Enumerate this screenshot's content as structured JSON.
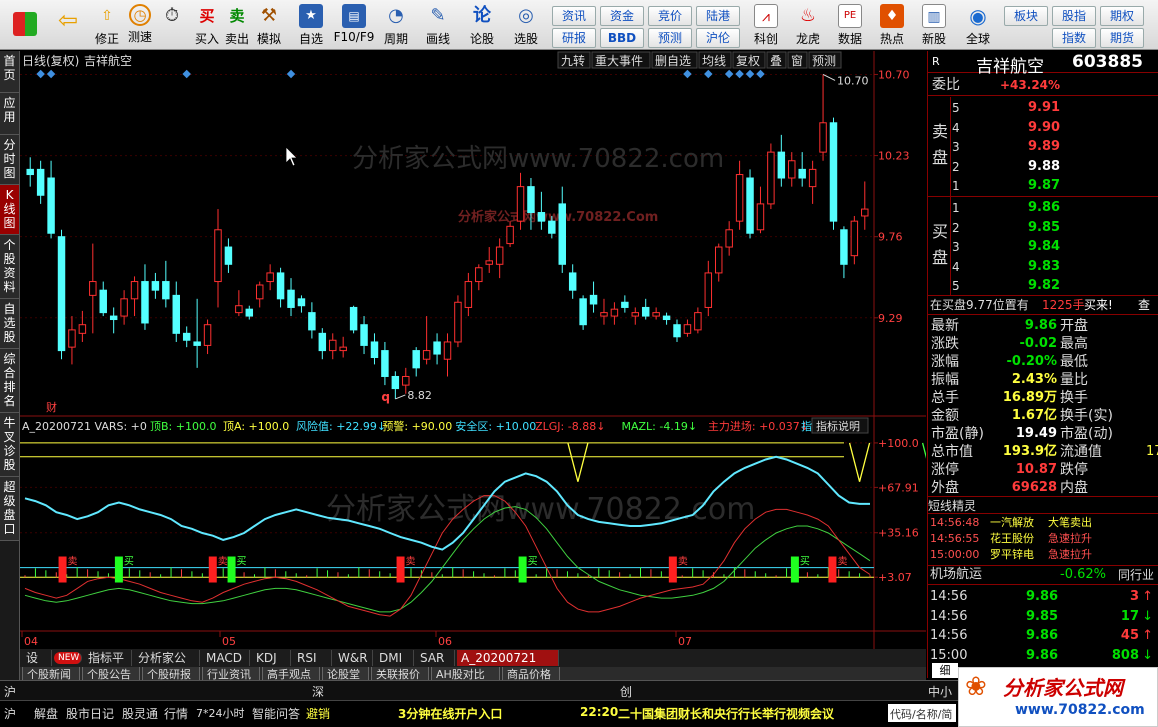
{
  "toolbar": {
    "buttons": [
      {
        "label": "",
        "icon": "grid-icon"
      },
      {
        "label": "",
        "icon": "back-arrow-icon"
      },
      {
        "label": "修正",
        "icon": "up-arrow-icon"
      },
      {
        "label": "测速",
        "icon": "clock-icon"
      },
      {
        "label": "买入",
        "icon": "buy-icon",
        "glyph": "买"
      },
      {
        "label": "卖出",
        "icon": "sell-icon",
        "glyph": "卖"
      },
      {
        "label": "模拟",
        "icon": "hammer-icon"
      },
      {
        "label": "自选",
        "icon": "star-icon"
      },
      {
        "label": "F10/F9",
        "icon": "f10-icon"
      },
      {
        "label": "周期",
        "icon": "period-icon"
      },
      {
        "label": "画线",
        "icon": "pencil-icon"
      },
      {
        "label": "论股",
        "icon": "discuss-icon",
        "glyph": "论"
      },
      {
        "label": "选股",
        "icon": "select-stock-icon"
      }
    ],
    "small_buttons": [
      "资讯",
      "资金",
      "竞价",
      "陆港",
      "研报",
      "BBD",
      "预测",
      "沪伦"
    ],
    "big_buttons": [
      {
        "label": "科创",
        "icon": "chart-icon"
      },
      {
        "label": "龙虎",
        "icon": "dragon-icon"
      },
      {
        "label": "数据",
        "icon": "data-icon"
      },
      {
        "label": "热点",
        "icon": "hot-icon"
      },
      {
        "label": "新股",
        "icon": "new-stock-icon"
      },
      {
        "label": "全球",
        "icon": "globe-icon"
      }
    ],
    "right_buttons": [
      "板块",
      "股指",
      "期权",
      "指数",
      "期货"
    ]
  },
  "sidebar": {
    "items": [
      {
        "label": "首页",
        "active": false
      },
      {
        "label": "应用",
        "active": false
      },
      {
        "label": "分时图",
        "active": false
      },
      {
        "label": "K线图",
        "active": true
      },
      {
        "label": "个股资料",
        "active": false
      },
      {
        "label": "自选股",
        "active": false
      },
      {
        "label": "综合排名",
        "active": false
      },
      {
        "label": "牛叉诊股",
        "active": false
      },
      {
        "label": "超级盘口",
        "active": false
      }
    ]
  },
  "chart_header": {
    "title": "日线(复权)",
    "stock": "吉祥航空",
    "tools": [
      "九转",
      "重大事件",
      "删自选",
      "均线",
      "复权",
      "叠",
      "窗",
      "预测"
    ]
  },
  "watermark": {
    "main": "分析家公式网www.70822.com",
    "small": "分析家公式网www.70822.Com"
  },
  "chart_data": [
    {
      "type": "candlestick",
      "title": "日线(复权)",
      "y_ticks": [
        "10.70",
        "10.23",
        "9.76",
        "9.29"
      ],
      "ylim": [
        8.75,
        10.72
      ],
      "high_label": "10.70",
      "low_label": "8.82",
      "fin_marker": "财",
      "q_marker": "q",
      "bull_color": "#ff3030",
      "bear_color": "#54ffff",
      "candles": [
        {
          "o": 10.15,
          "h": 10.22,
          "l": 10.05,
          "c": 10.12
        },
        {
          "o": 10.15,
          "h": 10.2,
          "l": 9.95,
          "c": 10.0
        },
        {
          "o": 10.1,
          "h": 10.2,
          "l": 9.75,
          "c": 9.78
        },
        {
          "o": 9.76,
          "h": 9.8,
          "l": 9.05,
          "c": 9.1
        },
        {
          "o": 9.12,
          "h": 9.3,
          "l": 9.02,
          "c": 9.22
        },
        {
          "o": 9.2,
          "h": 9.33,
          "l": 9.15,
          "c": 9.25
        },
        {
          "o": 9.42,
          "h": 9.72,
          "l": 9.2,
          "c": 9.5
        },
        {
          "o": 9.45,
          "h": 9.5,
          "l": 9.3,
          "c": 9.32
        },
        {
          "o": 9.3,
          "h": 9.35,
          "l": 9.2,
          "c": 9.28
        },
        {
          "o": 9.3,
          "h": 9.45,
          "l": 9.25,
          "c": 9.4
        },
        {
          "o": 9.4,
          "h": 9.53,
          "l": 9.3,
          "c": 9.5
        },
        {
          "o": 9.5,
          "h": 9.6,
          "l": 9.22,
          "c": 9.26
        },
        {
          "o": 9.5,
          "h": 9.55,
          "l": 9.4,
          "c": 9.45
        },
        {
          "o": 9.5,
          "h": 9.62,
          "l": 9.35,
          "c": 9.4
        },
        {
          "o": 9.42,
          "h": 9.5,
          "l": 9.15,
          "c": 9.2
        },
        {
          "o": 9.2,
          "h": 9.24,
          "l": 9.12,
          "c": 9.16
        },
        {
          "o": 9.15,
          "h": 9.4,
          "l": 9.0,
          "c": 9.13
        },
        {
          "o": 9.13,
          "h": 9.28,
          "l": 9.08,
          "c": 9.25
        },
        {
          "o": 9.5,
          "h": 9.92,
          "l": 9.35,
          "c": 9.8
        },
        {
          "o": 9.7,
          "h": 9.75,
          "l": 9.55,
          "c": 9.6
        },
        {
          "o": 9.32,
          "h": 9.45,
          "l": 9.3,
          "c": 9.36
        },
        {
          "o": 9.34,
          "h": 9.36,
          "l": 9.28,
          "c": 9.3
        },
        {
          "o": 9.4,
          "h": 9.5,
          "l": 9.35,
          "c": 9.48
        },
        {
          "o": 9.5,
          "h": 9.6,
          "l": 9.45,
          "c": 9.55
        },
        {
          "o": 9.55,
          "h": 9.58,
          "l": 9.35,
          "c": 9.4
        },
        {
          "o": 9.45,
          "h": 9.52,
          "l": 9.3,
          "c": 9.35
        },
        {
          "o": 9.4,
          "h": 9.42,
          "l": 9.32,
          "c": 9.36
        },
        {
          "o": 9.32,
          "h": 9.38,
          "l": 9.17,
          "c": 9.22
        },
        {
          "o": 9.2,
          "h": 9.23,
          "l": 9.05,
          "c": 9.1
        },
        {
          "o": 9.1,
          "h": 9.2,
          "l": 9.05,
          "c": 9.16
        },
        {
          "o": 9.1,
          "h": 9.18,
          "l": 9.06,
          "c": 9.12
        },
        {
          "o": 9.35,
          "h": 9.36,
          "l": 9.2,
          "c": 9.22
        },
        {
          "o": 9.25,
          "h": 9.3,
          "l": 9.08,
          "c": 9.13
        },
        {
          "o": 9.15,
          "h": 9.2,
          "l": 9.02,
          "c": 9.06
        },
        {
          "o": 9.1,
          "h": 9.15,
          "l": 8.9,
          "c": 8.95
        },
        {
          "o": 8.95,
          "h": 8.98,
          "l": 8.82,
          "c": 8.88
        },
        {
          "o": 8.9,
          "h": 9.0,
          "l": 8.85,
          "c": 8.95
        },
        {
          "o": 9.1,
          "h": 9.12,
          "l": 8.95,
          "c": 9.0
        },
        {
          "o": 9.05,
          "h": 9.3,
          "l": 9.02,
          "c": 9.1
        },
        {
          "o": 9.15,
          "h": 9.2,
          "l": 9.02,
          "c": 9.08
        },
        {
          "o": 9.05,
          "h": 9.2,
          "l": 8.95,
          "c": 9.15
        },
        {
          "o": 9.15,
          "h": 9.42,
          "l": 9.12,
          "c": 9.38
        },
        {
          "o": 9.35,
          "h": 9.55,
          "l": 9.3,
          "c": 9.5
        },
        {
          "o": 9.5,
          "h": 9.6,
          "l": 9.45,
          "c": 9.58
        },
        {
          "o": 9.6,
          "h": 9.7,
          "l": 9.55,
          "c": 9.62
        },
        {
          "o": 9.6,
          "h": 9.75,
          "l": 9.52,
          "c": 9.7
        },
        {
          "o": 9.72,
          "h": 9.85,
          "l": 9.7,
          "c": 9.82
        },
        {
          "o": 9.85,
          "h": 10.13,
          "l": 9.8,
          "c": 10.05
        },
        {
          "o": 10.05,
          "h": 10.1,
          "l": 9.8,
          "c": 9.9
        },
        {
          "o": 9.9,
          "h": 10.02,
          "l": 9.8,
          "c": 9.85
        },
        {
          "o": 9.85,
          "h": 9.88,
          "l": 9.75,
          "c": 9.78
        },
        {
          "o": 9.95,
          "h": 10.05,
          "l": 9.55,
          "c": 9.6
        },
        {
          "o": 9.55,
          "h": 9.6,
          "l": 9.4,
          "c": 9.45
        },
        {
          "o": 9.4,
          "h": 9.42,
          "l": 9.22,
          "c": 9.25
        },
        {
          "o": 9.42,
          "h": 9.5,
          "l": 9.32,
          "c": 9.37
        },
        {
          "o": 9.3,
          "h": 9.4,
          "l": 9.25,
          "c": 9.32
        },
        {
          "o": 9.3,
          "h": 9.38,
          "l": 9.25,
          "c": 9.34
        },
        {
          "o": 9.38,
          "h": 9.42,
          "l": 9.32,
          "c": 9.35
        },
        {
          "o": 9.3,
          "h": 9.35,
          "l": 9.25,
          "c": 9.32
        },
        {
          "o": 9.35,
          "h": 9.4,
          "l": 9.28,
          "c": 9.3
        },
        {
          "o": 9.3,
          "h": 9.35,
          "l": 9.28,
          "c": 9.32
        },
        {
          "o": 9.3,
          "h": 9.32,
          "l": 9.25,
          "c": 9.28
        },
        {
          "o": 9.25,
          "h": 9.28,
          "l": 9.15,
          "c": 9.18
        },
        {
          "o": 9.2,
          "h": 9.28,
          "l": 9.18,
          "c": 9.25
        },
        {
          "o": 9.22,
          "h": 9.35,
          "l": 9.2,
          "c": 9.32
        },
        {
          "o": 9.35,
          "h": 9.62,
          "l": 9.3,
          "c": 9.55
        },
        {
          "o": 9.55,
          "h": 9.72,
          "l": 9.5,
          "c": 9.7
        },
        {
          "o": 9.7,
          "h": 9.85,
          "l": 9.65,
          "c": 9.8
        },
        {
          "o": 9.85,
          "h": 10.2,
          "l": 9.8,
          "c": 10.12
        },
        {
          "o": 10.1,
          "h": 10.15,
          "l": 9.75,
          "c": 9.78
        },
        {
          "o": 9.8,
          "h": 10.05,
          "l": 9.78,
          "c": 9.95
        },
        {
          "o": 9.95,
          "h": 10.3,
          "l": 9.92,
          "c": 10.25
        },
        {
          "o": 10.25,
          "h": 10.35,
          "l": 10.05,
          "c": 10.1
        },
        {
          "o": 10.1,
          "h": 10.25,
          "l": 10.05,
          "c": 10.2
        },
        {
          "o": 10.15,
          "h": 10.25,
          "l": 10.05,
          "c": 10.1
        },
        {
          "o": 10.05,
          "h": 10.2,
          "l": 9.95,
          "c": 10.15
        },
        {
          "o": 10.25,
          "h": 10.7,
          "l": 10.2,
          "c": 10.42
        },
        {
          "o": 10.42,
          "h": 10.45,
          "l": 9.8,
          "c": 9.85
        },
        {
          "o": 9.8,
          "h": 9.82,
          "l": 9.52,
          "c": 9.6
        },
        {
          "o": 9.65,
          "h": 9.88,
          "l": 9.6,
          "c": 9.85
        },
        {
          "o": 9.88,
          "h": 10.08,
          "l": 9.8,
          "c": 9.92
        }
      ],
      "top_markers": [
        1,
        2,
        15,
        25,
        63,
        65,
        67,
        68,
        69,
        70
      ]
    },
    {
      "type": "line",
      "title": "A_20200721 VARS: +0",
      "legend": [
        {
          "text": "顶B: +100.0",
          "color": "#40ff40"
        },
        {
          "text": "顶A: +100.0",
          "color": "#ffff40"
        },
        {
          "text": "风险值: +22.99↓",
          "color": "#40e0ff"
        },
        {
          "text": "预警: +90.00",
          "color": "#ffff40"
        },
        {
          "text": "安全区: +10.00",
          "color": "#40e0ff"
        },
        {
          "text": "ZLGJ: -8.88↓",
          "color": "#ff3b3b"
        },
        {
          "text": "MAZL: -4.19↓",
          "color": "#40ff40"
        },
        {
          "text": "主力进场: +0.037↓",
          "color": "#ff3b3b"
        },
        {
          "text": "指标:",
          "color": "#40e0ff"
        }
      ],
      "explain_label": "指标说明",
      "y_ticks": [
        "+100.0",
        "+67.91",
        "+35.16",
        "+3.07"
      ],
      "ylim": [
        -30,
        105
      ],
      "risk_line": [
        60,
        58,
        55,
        50,
        48,
        45,
        47,
        50,
        55,
        57,
        55,
        52,
        50,
        48,
        45,
        40,
        38,
        35,
        33,
        30,
        32,
        35,
        40,
        45,
        48,
        50,
        52,
        50,
        48,
        46,
        45,
        44,
        42,
        40,
        38,
        35,
        32,
        30,
        28,
        25,
        23,
        28,
        35,
        45,
        55,
        65,
        72,
        75,
        78,
        76,
        72,
        65,
        55,
        48,
        45,
        43,
        42,
        41,
        40,
        40,
        41,
        42,
        44,
        46,
        48,
        55,
        65,
        72,
        78,
        82,
        85,
        88,
        90,
        88,
        85,
        82,
        78,
        70,
        62,
        57,
        56,
        56
      ],
      "red_line": [
        -5,
        -8,
        -10,
        -12,
        -10,
        -5,
        0,
        2,
        3,
        2,
        0,
        -2,
        -5,
        -8,
        -10,
        -12,
        -14,
        -15,
        -12,
        -8,
        -5,
        -2,
        0,
        2,
        3,
        2,
        0,
        -3,
        -6,
        -10,
        -14,
        -18,
        -20,
        -22,
        -24,
        -25,
        -20,
        -10,
        5,
        20,
        35,
        45,
        52,
        58,
        62,
        62,
        58,
        50,
        40,
        25,
        10,
        -5,
        -15,
        -20,
        -22,
        -22,
        -20,
        -18,
        -15,
        -12,
        -10,
        -8,
        -6,
        -5,
        -4,
        -2,
        5,
        15,
        28,
        38,
        45,
        50,
        52,
        52,
        50,
        48,
        45,
        40,
        30,
        20,
        10,
        5
      ],
      "green_line": [
        -10,
        -12,
        -14,
        -15,
        -14,
        -12,
        -10,
        -8,
        -6,
        -5,
        -6,
        -8,
        -10,
        -12,
        -14,
        -15,
        -16,
        -16,
        -15,
        -14,
        -12,
        -10,
        -8,
        -6,
        -5,
        -5,
        -6,
        -8,
        -10,
        -12,
        -14,
        -16,
        -18,
        -20,
        -22,
        -22,
        -20,
        -15,
        -8,
        0,
        10,
        20,
        30,
        38,
        45,
        50,
        53,
        54,
        52,
        46,
        38,
        28,
        18,
        10,
        5,
        0,
        -3,
        -6,
        -8,
        -10,
        -11,
        -12,
        -12,
        -11,
        -10,
        -8,
        -5,
        0,
        8,
        16,
        24,
        30,
        35,
        38,
        40,
        40,
        38,
        35,
        30,
        25,
        20,
        15
      ],
      "safe_level": 10,
      "alert_level": 90,
      "top_level": 100,
      "buy_markers": [
        [
          4,
          "卖"
        ],
        [
          20,
          "卖"
        ],
        [
          40,
          "卖"
        ],
        [
          69,
          "卖"
        ],
        [
          86,
          "卖"
        ]
      ],
      "sell_markers": [
        [
          10,
          "买"
        ],
        [
          22,
          "买"
        ],
        [
          53,
          "买"
        ],
        [
          82,
          "买"
        ]
      ],
      "v_markers": [
        53,
        80,
        87
      ]
    }
  ],
  "x_axis_labels": [
    "04",
    "05",
    "06",
    "07"
  ],
  "cursor": {
    "shown": true
  },
  "bottom_tabs": [
    "设置",
    "NEW",
    "指标平台",
    "分析家公式网",
    "MACD",
    "KDJ",
    "RSI",
    "W&R",
    "DMI",
    "SAR",
    "A_20200721"
  ],
  "info_tabs": [
    "个股新闻",
    "个股公告",
    "个股研报",
    "行业资讯",
    "高手观点",
    "论股堂",
    "关联报价",
    "AH股对比",
    "商品价格"
  ],
  "quote": {
    "r_flag": "R",
    "name": "吉祥航空",
    "code": "603885",
    "webi_label": "委比",
    "webi": "+43.24%",
    "sell_label": [
      "卖",
      "盘"
    ],
    "buy_label": [
      "买",
      "盘"
    ],
    "asks": [
      {
        "lv": "5",
        "p": "9.91"
      },
      {
        "lv": "4",
        "p": "9.90"
      },
      {
        "lv": "3",
        "p": "9.89"
      },
      {
        "lv": "2",
        "p": "9.88"
      },
      {
        "lv": "1",
        "p": "9.87"
      }
    ],
    "bids": [
      {
        "lv": "1",
        "p": "9.86"
      },
      {
        "lv": "2",
        "p": "9.85"
      },
      {
        "lv": "3",
        "p": "9.84"
      },
      {
        "lv": "4",
        "p": "9.83"
      },
      {
        "lv": "5",
        "p": "9.82"
      }
    ],
    "buy_position_text": "在买盘9.77位置有",
    "buy_position_vol": "1225手",
    "buy_button": "买来!",
    "check_button": "查",
    "stats": [
      {
        "l": "最新",
        "v": "9.86",
        "c": "grn",
        "l2": "开盘",
        "v2": ""
      },
      {
        "l": "涨跌",
        "v": "-0.02",
        "c": "grn",
        "l2": "最高",
        "v2": ""
      },
      {
        "l": "涨幅",
        "v": "-0.20%",
        "c": "grn",
        "l2": "最低",
        "v2": ""
      },
      {
        "l": "振幅",
        "v": "2.43%",
        "c": "yel",
        "l2": "量比",
        "v2": ""
      },
      {
        "l": "总手",
        "v": "16.89万",
        "c": "yel",
        "l2": "换手",
        "v2": ""
      },
      {
        "l": "金额",
        "v": "1.67亿",
        "c": "yel",
        "l2": "换手(实)",
        "v2": ""
      },
      {
        "l": "市盈(静)",
        "v": "19.49",
        "c": "wht",
        "l2": "市盈(动)",
        "v2": ""
      },
      {
        "l": "总市值",
        "v": "193.9亿",
        "c": "yel",
        "l2": "流通值",
        "v2": "17"
      },
      {
        "l": "涨停",
        "v": "10.87",
        "c": "red",
        "l2": "跌停",
        "v2": ""
      },
      {
        "l": "外盘",
        "v": "69628",
        "c": "red",
        "l2": "内盘",
        "v2": ""
      }
    ],
    "elves_title": "短线精灵",
    "elves": [
      {
        "t": "14:56:48",
        "n": "一汽解放",
        "e": "大笔卖出"
      },
      {
        "t": "14:56:55",
        "n": "花王股份",
        "e": "急速拉升"
      },
      {
        "t": "15:00:00",
        "n": "罗平锌电",
        "e": "急速拉升"
      }
    ],
    "sector_name": "机场航运",
    "sector_change": "-0.62%",
    "sector_more": "同行业",
    "ticks": [
      {
        "t": "14:56",
        "p": "9.86",
        "v": "3",
        "dir": "up"
      },
      {
        "t": "14:56",
        "p": "9.85",
        "v": "17",
        "dir": "down"
      },
      {
        "t": "14:56",
        "p": "9.86",
        "v": "45",
        "dir": "up"
      },
      {
        "t": "15:00",
        "p": "9.86",
        "v": "808",
        "dir": "down"
      }
    ],
    "detail_tab": "细"
  },
  "ticker": {
    "items": [
      "沪",
      "深",
      "创",
      "中小"
    ]
  },
  "statusbar": {
    "items": [
      "沪",
      "解盘",
      "股市日记",
      "股灵通",
      "行情",
      "7*24小时",
      "智能问答",
      "避销"
    ],
    "promo": "3分钟在线开户入口",
    "news_time": "22:20",
    "news": "二十国集团财长和央行行长举行视频会议",
    "search": "代码/名称/简拼",
    "brand": "分析家公式网",
    "brand_url": "www.70822.com"
  }
}
